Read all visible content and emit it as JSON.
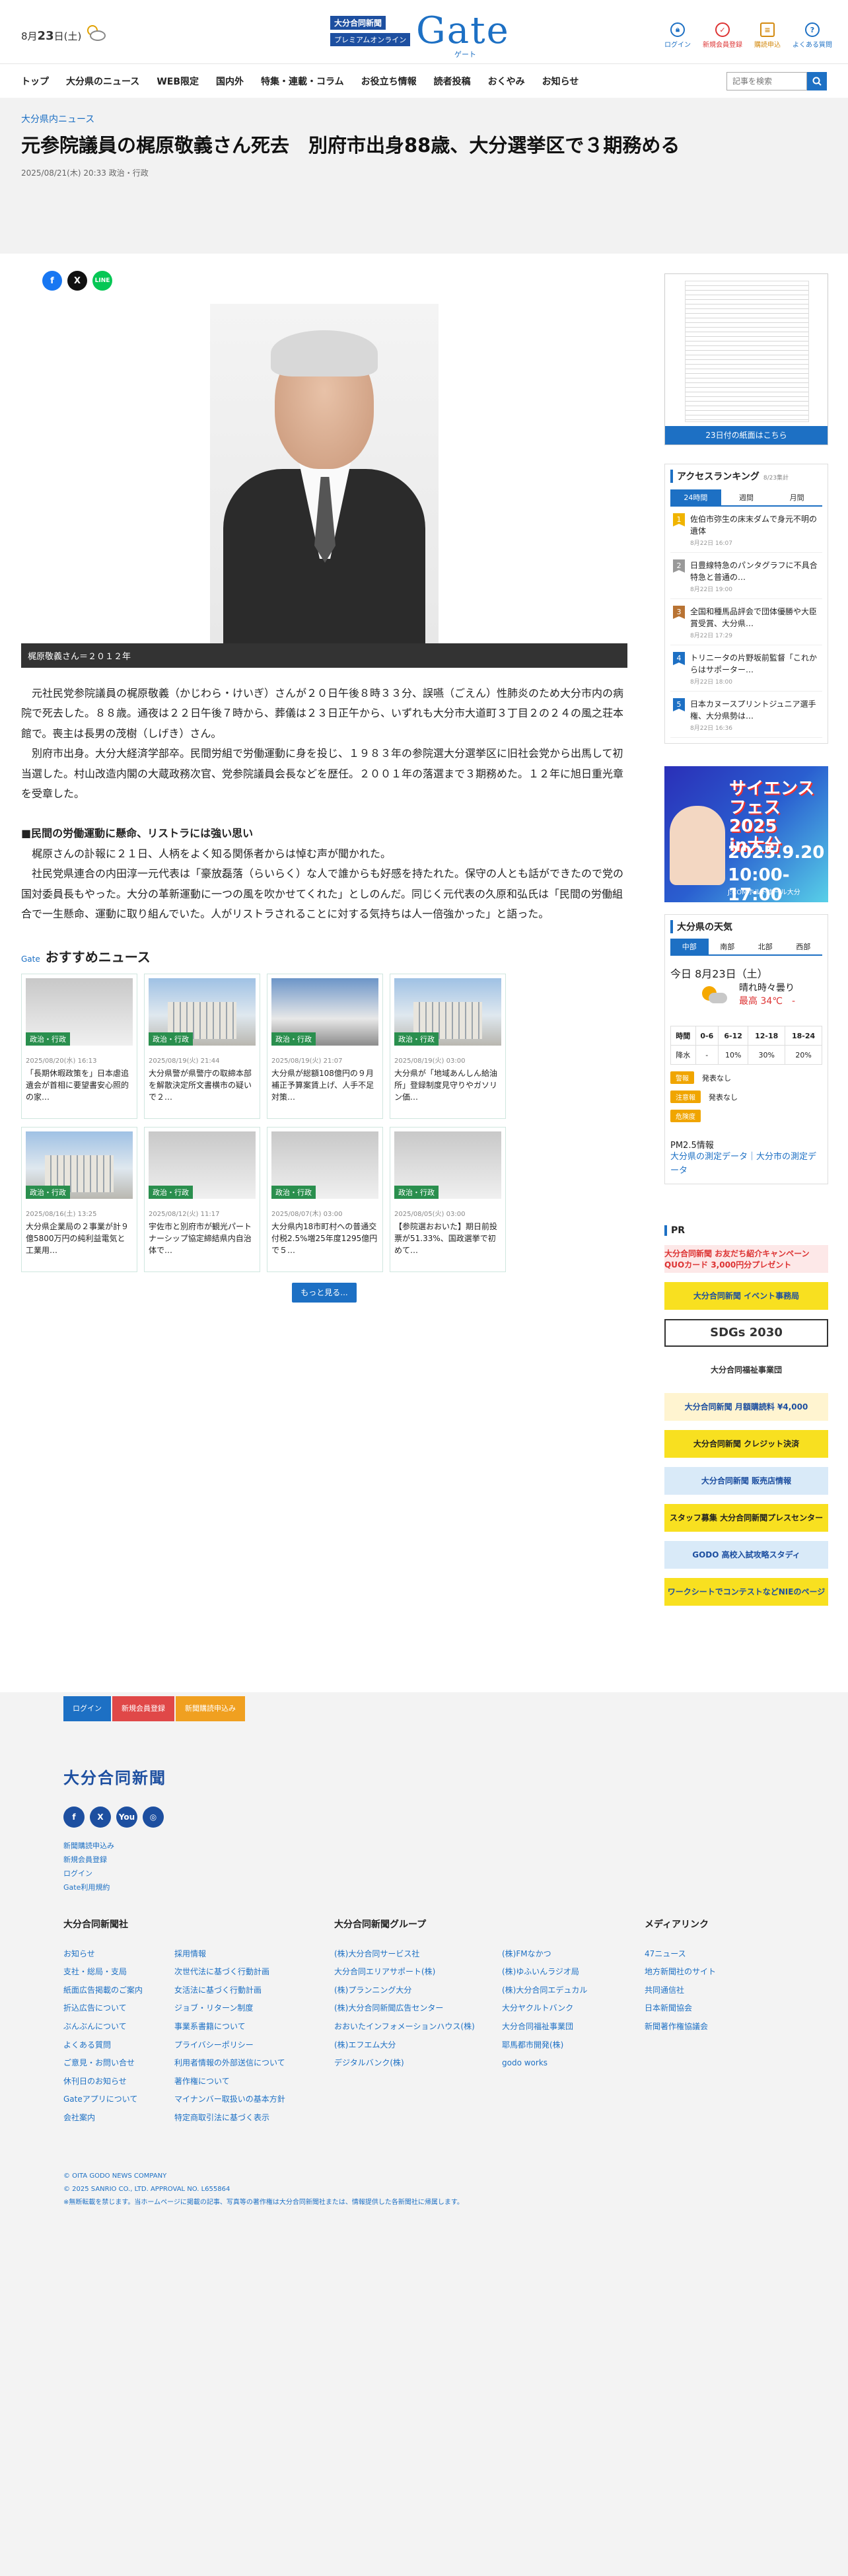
{
  "header": {
    "date": "8月",
    "date_day": "23",
    "date_rest": "日(土)",
    "logo_top": "大分合同新聞",
    "logo_sub": "プレミアムオンライン",
    "logo_gate": "Gate",
    "logo_kana": "ゲート",
    "tools": [
      "ログイン",
      "新規会員登録",
      "購読申込",
      "よくある質問"
    ]
  },
  "nav": {
    "items": [
      "トップ",
      "大分県のニュース",
      "WEB限定",
      "国内外",
      "特集・連載・コラム",
      "お役立ち情報",
      "読者投稿",
      "おくやみ",
      "お知らせ"
    ],
    "search_placeholder": "記事を検索"
  },
  "article": {
    "category": "大分県内ニュース",
    "title": "元参院議員の梶原敬義さん死去　別府市出身88歳、大分選挙区で３期務める",
    "datetime": "2025/08/21(木) 20:33",
    "tag": "政治・行政",
    "share": [
      "f",
      "X",
      "LINE"
    ],
    "caption": "梶原敬義さん＝２０１２年",
    "paragraphs": [
      "　元社民党参院議員の梶原敬義（かじわら・けいぎ）さんが２０日午後８時３３分、誤嚥（ごえん）性肺炎のため大分市内の病院で死去した。８８歳。通夜は２２日午後７時から、葬儀は２３日正午から、いずれも大分市大道町３丁目２の２４の風之荘本館で。喪主は長男の茂樹（しげき）さん。",
      "　別府市出身。大分大経済学部卒。民間労組で労働運動に身を投じ、１９８３年の参院選大分選挙区に旧社会党から出馬して初当選した。村山改造内閣の大蔵政務次官、党参院議員会長などを歴任。２００１年の落選まで３期務めた。１２年に旭日重光章を受章した。"
    ],
    "subhead": "■民間の労働運動に懸命、リストラには強い思い",
    "paragraphs2": [
      "　梶原さんの訃報に２１日、人柄をよく知る関係者からは悼む声が聞かれた。",
      "　社民党県連合の内田淳一元代表は「豪放磊落（らいらく）な人で誰からも好感を持たれた。保守の人とも話ができたので党の国対委員長もやった。大分の革新運動に一つの風を吹かせてくれた」としのんだ。同じく元代表の久原和弘氏は「民間の労働組合で一生懸命、運動に取り組んでいた。人がリストラされることに対する気持ちは人一倍強かった」と語った。"
    ]
  },
  "recommend": {
    "gate": "Gate",
    "title": "おすすめニュース",
    "tag": "政治・行政",
    "cards": [
      {
        "date": "2025/08/20(水) 16:13",
        "title": "「長期休暇政策を」日本虐追遺会が首相に要望書安心照的の家…"
      },
      {
        "date": "2025/08/19(火) 21:44",
        "title": "大分県警が県警庁の取締本部を解散決定所文書横市の疑いで２…"
      },
      {
        "date": "2025/08/19(火) 21:07",
        "title": "大分県が総額108億円の９月補正予算案賃上げ、人手不足対策…"
      },
      {
        "date": "2025/08/19(火) 03:00",
        "title": "大分県が「地域あんしん給油所」登録制度見守りやガソリン価…"
      },
      {
        "date": "2025/08/16(土) 13:25",
        "title": "大分県企業局の２事業が計９億5800万円の純利益電気と工業用…"
      },
      {
        "date": "2025/08/12(火) 11:17",
        "title": "宇佐市と別府市が観光パートナーシップ協定締結県内自治体で…"
      },
      {
        "date": "2025/08/07(木) 03:00",
        "title": "大分県内18市町村への普通交付税2.5%増25年度1295億円で５…"
      },
      {
        "date": "2025/08/05(火) 03:00",
        "title": "【参院選おおいた】期日前投票が51.33%、国政選挙で初めて…"
      }
    ],
    "more": "もっと見る..."
  },
  "sidebar": {
    "paper_button": "23日付の紙面はこちら",
    "ranking_title": "アクセスランキング",
    "ranking_note": "8/23集計",
    "ranking_tabs": [
      "24時間",
      "週間",
      "月間"
    ],
    "ranking": [
      {
        "title": "佐伯市弥生の床末ダムで身元不明の遺体",
        "date": "8月22日 16:07"
      },
      {
        "title": "日豊線特急のパンタグラフに不具合　特急と普通の…",
        "date": "8月22日 19:00"
      },
      {
        "title": "全国和種馬品評会で団体優勝や大臣賞受賞、大分県…",
        "date": "8月22日 17:29"
      },
      {
        "title": "トリニータの片野坂前監督「これからはサポーター…",
        "date": "8月22日 18:00"
      },
      {
        "title": "日本カヌースプリントジュニア選手権、大分県勢は…",
        "date": "8月22日 16:36"
      }
    ],
    "science_banner": {
      "title1": "サイエンス",
      "title2": "フェス2025",
      "title3": "in大分",
      "date": "2025.9.20",
      "time": "10:00-17:00",
      "place": "J:COMホルトホール大分"
    },
    "weather": {
      "title": "大分県の天気",
      "tabs": [
        "中部",
        "南部",
        "北部",
        "西部"
      ],
      "date": "今日 8月23日（土）",
      "desc": "晴れ時々曇り",
      "temp": "最高 34℃　-",
      "headers": [
        "時間",
        "0-6",
        "6-12",
        "12-18",
        "18-24"
      ],
      "rain_label": "降水",
      "rain": [
        "-",
        "10%",
        "30%",
        "20%"
      ],
      "alerts": [
        {
          "badge": "警報",
          "text": "発表なし"
        },
        {
          "badge": "注意報",
          "text": "発表なし"
        },
        {
          "badge": "危険度",
          "text": ""
        }
      ],
      "pm_title": "PM2.5情報",
      "pm_link": "大分県の測定データ｜大分市の測定データ"
    },
    "pr_title": "PR",
    "pr": [
      "大分合同新聞 お友だち紹介キャンペーン QUOカード 3,000円分プレゼント",
      "大分合同新聞 イベント事務局",
      "SDGs 2030",
      "大分合同福祉事業団",
      "大分合同新聞 月額購読料 ¥4,000",
      "大分合同新聞 クレジット決済",
      "大分合同新聞 販売店情報",
      "スタッフ募集 大分合同新聞プレスセンター",
      "GODO 高校入試攻略スタディ",
      "ワークシートでコンテストなどNIEのページ"
    ]
  },
  "footer": {
    "buttons": [
      "ログイン",
      "新規会員登録",
      "新聞購読申込み"
    ],
    "logo": "大分合同新聞",
    "social": [
      "f",
      "X",
      "You",
      "◎"
    ],
    "links": [
      "新聞購読申込み",
      "新規会員登録",
      "ログイン",
      "Gate利用規約"
    ],
    "col1_title": "大分合同新聞社",
    "col1a": [
      "お知らせ",
      "支社・総局・支局",
      "紙面広告掲載のご案内",
      "折込広告について",
      "ぶんぶんについて",
      "よくある質問",
      "ご意見・お問い合せ",
      "休刊日のお知らせ",
      "Gateアプリについて",
      "会社案内"
    ],
    "col1b": [
      "採用情報",
      "次世代法に基づく行動計画",
      "女活法に基づく行動計画",
      "ジョブ・リターン制度",
      "事業系書籍について",
      "プライバシーポリシー",
      "利用者情報の外部送信について",
      "著作権について",
      "マイナンバー取扱いの基本方針",
      "特定商取引法に基づく表示"
    ],
    "col2_title": "大分合同新聞グループ",
    "col2a": [
      "(株)大分合同サービス社",
      "大分合同エリアサポート(株)",
      "(株)プランニング大分",
      "(株)大分合同新聞広告センター",
      "おおいたインフォメーションハウス(株)",
      "(株)エフエム大分",
      "デジタルバンク(株)"
    ],
    "col2b": [
      "(株)FMなかつ",
      "(株)ゆふいんラジオ局",
      "(株)大分合同エデュカル",
      "大分ヤクルトバンク",
      "大分合同福祉事業団",
      "耶馬都市開発(株)",
      "godo works"
    ],
    "col3_title": "メディアリンク",
    "col3": [
      "47ニュース",
      "地方新聞社のサイト",
      "共同通信社",
      "日本新聞協会",
      "新聞著作権協議会"
    ],
    "copyright": [
      "© OITA GODO NEWS COMPANY",
      "© 2025 SANRIO CO., LTD. APPROVAL NO. L655864",
      "※無断転載を禁じます。当ホームページに掲載の記事、写真等の著作権は大分合同新聞社または、情報提供した各新聞社に帰属します。"
    ]
  },
  "colors": {
    "accent": "#1d70c4",
    "brand": "#1d4fa0",
    "tag_green": "#2a8f4e",
    "footer_reg": "#e04848",
    "footer_apply": "#f0a020"
  }
}
